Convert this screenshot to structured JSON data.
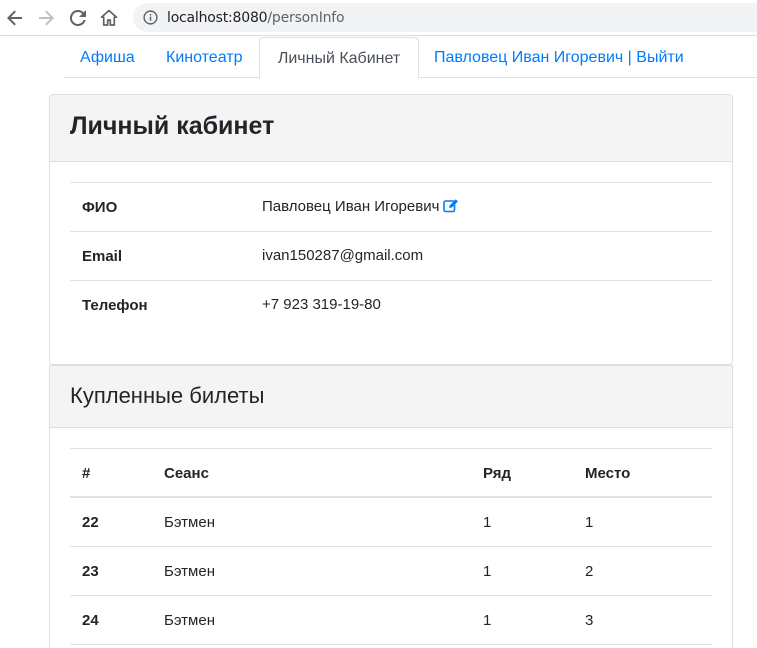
{
  "browser": {
    "url_host": "localhost:8080",
    "url_path": "/personInfo",
    "icons": [
      "back-arrow-icon",
      "forward-arrow-icon",
      "reload-icon",
      "home-icon",
      "info-icon"
    ]
  },
  "nav": {
    "tabs": [
      {
        "label": "Афиша",
        "active": false
      },
      {
        "label": "Кинотеатр",
        "active": false
      },
      {
        "label": "Личный Кабинет",
        "active": true
      },
      {
        "label": "Павловец Иван Игоревич | Выйти",
        "active": false
      }
    ]
  },
  "profile": {
    "title": "Личный кабинет",
    "rows": [
      {
        "label": "ФИО",
        "value": "Павловец Иван Игоревич",
        "editable": true
      },
      {
        "label": "Email",
        "value": "ivan150287@gmail.com"
      },
      {
        "label": "Телефон",
        "value": "+7 923 319-19-80"
      }
    ]
  },
  "tickets": {
    "title": "Купленные билеты",
    "headers": [
      "#",
      "Сеанс",
      "Ряд",
      "Место"
    ],
    "rows": [
      {
        "id": "22",
        "session": "Бэтмен",
        "row": "1",
        "seat": "1"
      },
      {
        "id": "23",
        "session": "Бэтмен",
        "row": "1",
        "seat": "2"
      },
      {
        "id": "24",
        "session": "Бэтмен",
        "row": "1",
        "seat": "3"
      }
    ]
  },
  "colors": {
    "link": "#007bff",
    "header_bg": "#f4f4f4",
    "edit_icon": "#007bff"
  }
}
